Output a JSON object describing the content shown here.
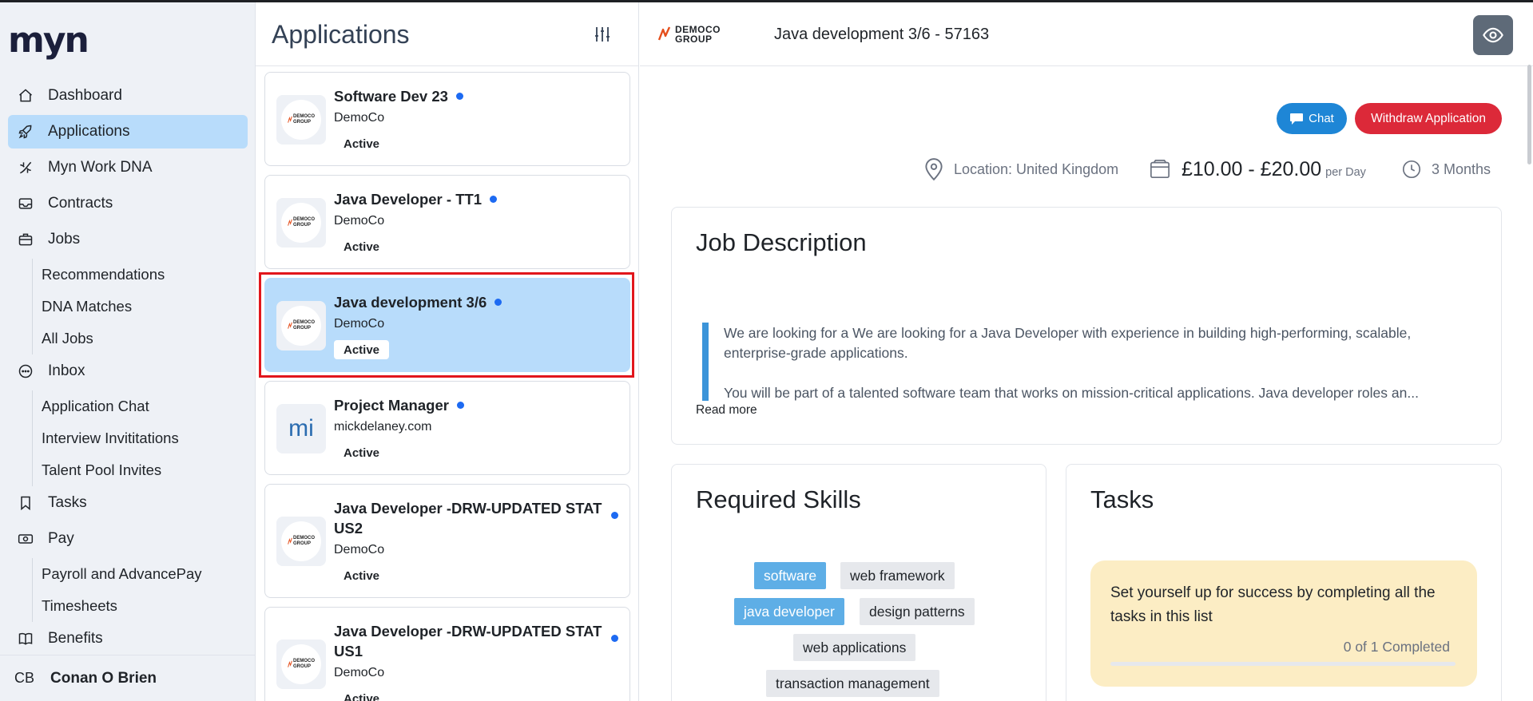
{
  "app": {
    "logo": "myn"
  },
  "sidebar": {
    "items": [
      {
        "label": "Dashboard",
        "icon": "home-icon"
      },
      {
        "label": "Applications",
        "icon": "rocket-icon",
        "active": true
      },
      {
        "label": "Myn Work DNA",
        "icon": "dna-icon"
      },
      {
        "label": "Contracts",
        "icon": "inbox-tray-icon"
      },
      {
        "label": "Jobs",
        "icon": "briefcase-icon",
        "children": [
          "Recommendations",
          "DNA Matches",
          "All Jobs"
        ]
      },
      {
        "label": "Inbox",
        "icon": "chat-bubble-icon",
        "children": [
          "Application Chat",
          "Interview Invititations",
          "Talent Pool Invites"
        ]
      },
      {
        "label": "Tasks",
        "icon": "bookmark-icon"
      },
      {
        "label": "Pay",
        "icon": "banknote-icon",
        "children": [
          "Payroll and AdvancePay",
          "Timesheets"
        ]
      },
      {
        "label": "Benefits",
        "icon": "book-icon"
      }
    ],
    "profile": {
      "initials": "CB",
      "name": "Conan O Brien"
    }
  },
  "applications": {
    "title": "Applications",
    "filter_icon": "sliders-icon",
    "cards": [
      {
        "title": "Software Dev 23",
        "company": "DemoCo",
        "status": "Active",
        "logo": "democo-logo",
        "unread": true
      },
      {
        "title": "Java Developer - TT1",
        "company": "DemoCo",
        "status": "Active",
        "logo": "democo-logo",
        "unread": true
      },
      {
        "title": "Java development 3/6",
        "company": "DemoCo",
        "status": "Active",
        "logo": "democo-logo",
        "unread": true,
        "selected": true
      },
      {
        "title": "Project Manager",
        "company": "mickdelaney.com",
        "status": "Active",
        "logo": "mi",
        "unread": true
      },
      {
        "title": "Java Developer -DRW-UPDATED STATUS2",
        "title_line1": "Java Developer -DRW-UPDATED STAT",
        "title_line2": "US2",
        "company": "DemoCo",
        "status": "Active",
        "logo": "democo-logo",
        "unread": true
      },
      {
        "title": "Java Developer -DRW-UPDATED STATUS1",
        "title_line1": "Java Developer -DRW-UPDATED STAT",
        "title_line2": "US1",
        "company": "DemoCo",
        "status": "Active",
        "logo": "democo-logo",
        "unread": true
      }
    ],
    "logo_text_line1": "DEMOCO",
    "logo_text_line2": "GROUP"
  },
  "detail": {
    "company_logo_line1": "DEMOCO",
    "company_logo_line2": "GROUP",
    "title": "Java development 3/6 - 57163",
    "eye_icon": "eye-icon",
    "chat_label": "Chat",
    "withdraw_label": "Withdraw Application",
    "location": "Location: United Kingdom",
    "pay": "£10.00 - £20.00",
    "pay_unit": "per Day",
    "duration": "3 Months",
    "description": {
      "heading": "Job Description",
      "paragraph1": "We are looking for a We are looking for a Java Developer with experience in building high-performing, scalable, enterprise-grade applications.",
      "paragraph2": "You will be part of a talented software team that works on mission-critical applications. Java developer roles an...",
      "read_more": "Read more"
    },
    "skills": {
      "heading": "Required Skills",
      "items": [
        "software",
        "web framework",
        "java developer",
        "design patterns",
        "web applications",
        "transaction management"
      ],
      "highlighted": [
        "software",
        "java developer"
      ]
    },
    "tasks": {
      "heading": "Tasks",
      "message": "Set yourself up for success by completing all the tasks in this list",
      "count": "0 of 1 Completed",
      "completed": 0,
      "total": 1
    }
  },
  "colors": {
    "accent": "#1e86d6",
    "danger": "#dc2939",
    "selected": "#b8dcfb",
    "unread_dot": "#1d6af2",
    "tasks_bg": "#fcedc4"
  }
}
